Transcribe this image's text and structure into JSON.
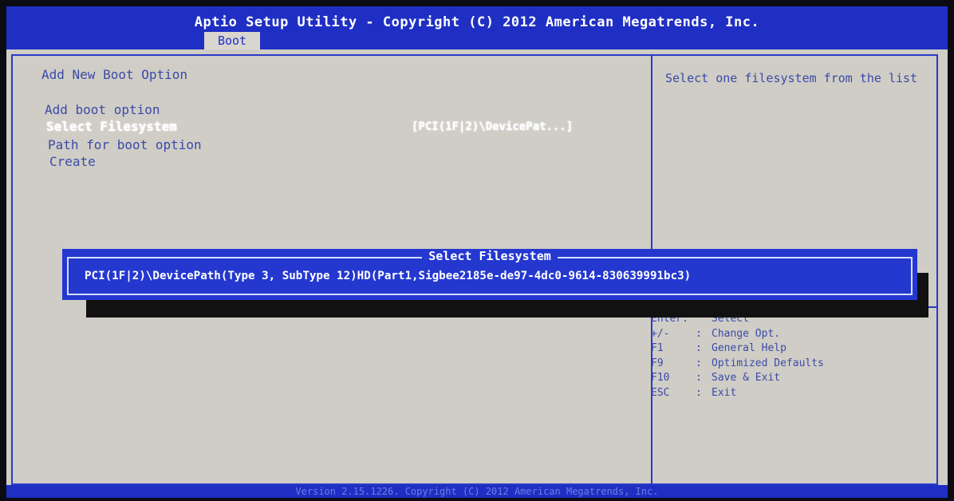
{
  "header": {
    "title": "Aptio Setup Utility - Copyright (C) 2012 American Megatrends, Inc.",
    "active_tab": "Boot"
  },
  "main": {
    "section_title": "Add New Boot Option",
    "items": [
      {
        "label": "Add boot option"
      },
      {
        "label": "Select Filesystem",
        "value": "[PCI(1F|2)\\DevicePat...]"
      },
      {
        "label": "Path for boot option"
      },
      {
        "label": "Create"
      }
    ]
  },
  "help": {
    "text": "Select one filesystem from the list"
  },
  "keys": [
    {
      "key": "Enter:",
      "sep": "",
      "desc": "Select"
    },
    {
      "key": "+/-",
      "sep": ":",
      "desc": "Change Opt."
    },
    {
      "key": "F1",
      "sep": ":",
      "desc": "General Help"
    },
    {
      "key": "F9",
      "sep": ":",
      "desc": "Optimized Defaults"
    },
    {
      "key": "F10",
      "sep": ":",
      "desc": "Save & Exit"
    },
    {
      "key": "ESC",
      "sep": ":",
      "desc": "Exit"
    }
  ],
  "popup": {
    "title": "Select Filesystem",
    "option": "PCI(1F|2)\\DevicePath(Type 3, SubType 12)HD(Part1,Sigbee2185e-de97-4dc0-9614-830639991bc3)"
  },
  "footer": {
    "text": "Version 2.15.1226. Copyright (C) 2012 American Megatrends, Inc."
  },
  "colors": {
    "bios_blue": "#1f2fc4",
    "background": "#cfcdc6",
    "text_blue": "#3c4aa8",
    "highlight": "#ffffff"
  }
}
